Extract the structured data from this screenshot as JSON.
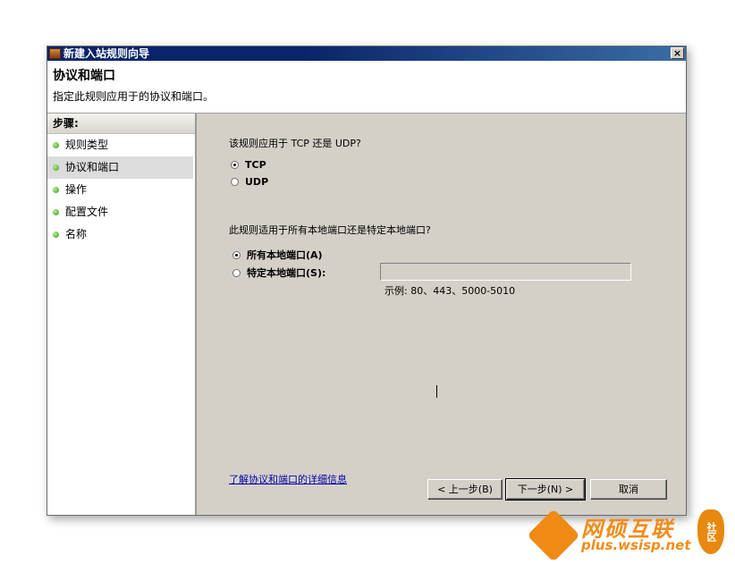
{
  "window": {
    "title": "新建入站规则向导",
    "close_glyph": "×"
  },
  "header": {
    "title": "协议和端口",
    "subtitle": "指定此规则应用于的协议和端口。"
  },
  "steps": {
    "heading": "步骤:",
    "items": [
      {
        "label": "规则类型",
        "active": false
      },
      {
        "label": "协议和端口",
        "active": true
      },
      {
        "label": "操作",
        "active": false
      },
      {
        "label": "配置文件",
        "active": false
      },
      {
        "label": "名称",
        "active": false
      }
    ]
  },
  "protocol": {
    "question": "该规则应用于 TCP 还是 UDP?",
    "options": [
      {
        "label": "TCP",
        "checked": true
      },
      {
        "label": "UDP",
        "checked": false
      }
    ]
  },
  "ports": {
    "question": "此规则适用于所有本地端口还是特定本地端口?",
    "all_label": "所有本地端口(A)",
    "specific_label": "特定本地端口(S):",
    "selected": "all",
    "input_value": "",
    "example": "示例: 80、443、5000-5010"
  },
  "link": "了解协议和端口的详细信息",
  "buttons": {
    "back": "< 上一步(B)",
    "next": "下一步(N) >",
    "cancel": "取消"
  },
  "watermark": {
    "title": "网硕互联",
    "url": "plus.wsisp.net",
    "badge": "社区"
  },
  "colors": {
    "title_bar": "#0a246a",
    "panel_bg": "#d4d0c8",
    "link": "#0000aa",
    "step_dot": "#2f9a18",
    "watermark": "#f28c1a"
  }
}
